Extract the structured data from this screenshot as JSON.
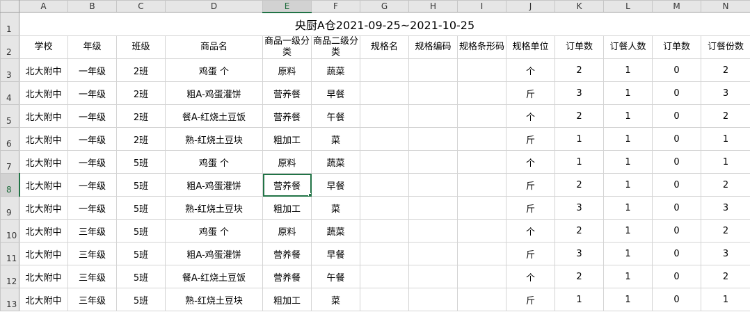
{
  "columns": [
    "A",
    "B",
    "C",
    "D",
    "E",
    "F",
    "G",
    "H",
    "I",
    "J",
    "K",
    "L",
    "M",
    "N"
  ],
  "row_numbers": [
    "1",
    "2",
    "3",
    "4",
    "5",
    "6",
    "7",
    "8",
    "9",
    "10",
    "11",
    "12",
    "13"
  ],
  "active_cell": {
    "column": "E",
    "row": "8"
  },
  "title": "央厨A仓2021-09-25~2021-10-25",
  "headers": [
    "学校",
    "年级",
    "班级",
    "商品名",
    "商品一级分类",
    "商品二级分类",
    "规格名",
    "规格编码",
    "规格条形码",
    "规格单位",
    "订单数",
    "订餐人数",
    "订单数",
    "订餐份数"
  ],
  "rows": [
    [
      "北大附中",
      "一年级",
      "2班",
      "鸡蛋 个",
      "原料",
      "蔬菜",
      "",
      "",
      "",
      "个",
      "2",
      "1",
      "0",
      "2"
    ],
    [
      "北大附中",
      "一年级",
      "2班",
      "粗A-鸡蛋灌饼",
      "营养餐",
      "早餐",
      "",
      "",
      "",
      "斤",
      "3",
      "1",
      "0",
      "3"
    ],
    [
      "北大附中",
      "一年级",
      "2班",
      "餐A-红烧土豆饭",
      "营养餐",
      "午餐",
      "",
      "",
      "",
      "个",
      "2",
      "1",
      "0",
      "2"
    ],
    [
      "北大附中",
      "一年级",
      "2班",
      "熟-红烧土豆块",
      "粗加工",
      "菜",
      "",
      "",
      "",
      "斤",
      "1",
      "1",
      "0",
      "1"
    ],
    [
      "北大附中",
      "一年级",
      "5班",
      "鸡蛋 个",
      "原料",
      "蔬菜",
      "",
      "",
      "",
      "个",
      "1",
      "1",
      "0",
      "1"
    ],
    [
      "北大附中",
      "一年级",
      "5班",
      "粗A-鸡蛋灌饼",
      "营养餐",
      "早餐",
      "",
      "",
      "",
      "斤",
      "2",
      "1",
      "0",
      "2"
    ],
    [
      "北大附中",
      "一年级",
      "5班",
      "熟-红烧土豆块",
      "粗加工",
      "菜",
      "",
      "",
      "",
      "斤",
      "3",
      "1",
      "0",
      "3"
    ],
    [
      "北大附中",
      "三年级",
      "5班",
      "鸡蛋 个",
      "原料",
      "蔬菜",
      "",
      "",
      "",
      "个",
      "2",
      "1",
      "0",
      "2"
    ],
    [
      "北大附中",
      "三年级",
      "5班",
      "粗A-鸡蛋灌饼",
      "营养餐",
      "早餐",
      "",
      "",
      "",
      "斤",
      "3",
      "1",
      "0",
      "3"
    ],
    [
      "北大附中",
      "三年级",
      "5班",
      "餐A-红烧土豆饭",
      "营养餐",
      "午餐",
      "",
      "",
      "",
      "个",
      "2",
      "1",
      "0",
      "2"
    ],
    [
      "北大附中",
      "三年级",
      "5班",
      "熟-红烧土豆块",
      "粗加工",
      "菜",
      "",
      "",
      "",
      "斤",
      "1",
      "1",
      "0",
      "1"
    ]
  ],
  "colors": {
    "accent": "#217346",
    "gridline": "#d4d4d4",
    "header_bg": "#e6e6e6"
  }
}
